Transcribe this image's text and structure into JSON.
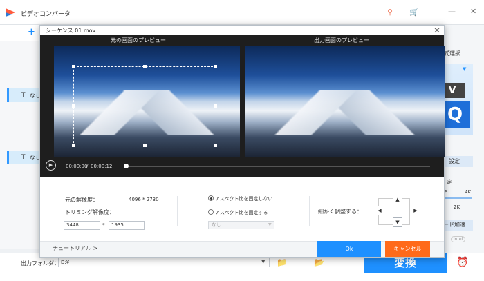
{
  "app": {
    "title": "ビデオコンバータ",
    "add_symbol": "+",
    "subtitle_chip": "なし",
    "subtitle_icon": "T",
    "icons": [
      "key-icon",
      "cart-icon",
      "minimize-icon",
      "close-icon",
      "folder-icon",
      "alarm-icon"
    ]
  },
  "right_panel": {
    "format_select": "式選択",
    "ext_badge": "V",
    "q_badge": "Q",
    "settings": "設定",
    "resolution": "定",
    "quality_low": "P",
    "quality_high": "4K",
    "quality_value": "2K",
    "hw_accel": "ード加速",
    "intel": "intel"
  },
  "bottom": {
    "output_label": "出力フォルダ：",
    "output_path": "D:¥",
    "convert": "変換"
  },
  "dialog": {
    "title": "シーケンス 01.mov",
    "source_preview": "元の画面のプレビュー",
    "output_preview": "出力画面のプレビュー",
    "current_time": "00:00:00",
    "time_separator": "/",
    "total_time": "00:00:12",
    "orig_resolution_label": "元の解像度：",
    "orig_resolution_value": "4096 * 2730",
    "trim_resolution_label": "トリミング解像度：",
    "trim_width": "3448",
    "trim_times": "*",
    "trim_height": "1935",
    "aspect_free": "アスペクト比を固定しない",
    "aspect_fixed": "アスペクト比を固定する",
    "aspect_select": "なし",
    "fine_adjust": "細かく調整する：",
    "tutorial": "チュートリアル >",
    "ok": "Ok",
    "cancel": "キャンセル"
  },
  "colors": {
    "accent": "#1e90ff",
    "cancel": "#ff6a1a"
  }
}
